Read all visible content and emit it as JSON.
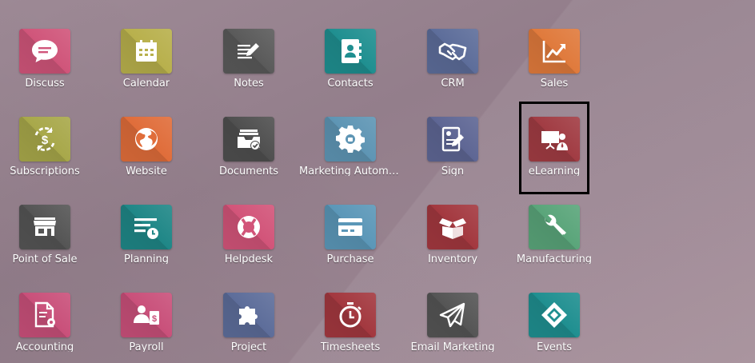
{
  "apps": [
    {
      "label": "Discuss",
      "icon": "chat-bubble-icon",
      "color": "#d0557a"
    },
    {
      "label": "Calendar",
      "icon": "calendar-icon",
      "color": "#b8b04c"
    },
    {
      "label": "Notes",
      "icon": "notes-icon",
      "color": "#5a5a5a"
    },
    {
      "label": "Contacts",
      "icon": "contacts-book-icon",
      "color": "#1f8f90"
    },
    {
      "label": "CRM",
      "icon": "handshake-icon",
      "color": "#5d6d9a"
    },
    {
      "label": "Sales",
      "icon": "chart-growth-icon",
      "color": "#e07a3c"
    },
    {
      "label": "Subscriptions",
      "icon": "recurring-dollar-icon",
      "color": "#a8a84a"
    },
    {
      "label": "Website",
      "icon": "globe-icon",
      "color": "#e06d3a"
    },
    {
      "label": "Documents",
      "icon": "document-tray-icon",
      "color": "#4f4f4f"
    },
    {
      "label": "Marketing Automat...",
      "icon": "gear-icon",
      "color": "#5e95b4"
    },
    {
      "label": "Sign",
      "icon": "signed-document-icon",
      "color": "#5e6694"
    },
    {
      "label": "eLearning",
      "icon": "presentation-teacher-icon",
      "color": "#a13c43"
    },
    {
      "label": "Point of Sale",
      "icon": "storefront-icon",
      "color": "#555555"
    },
    {
      "label": "Planning",
      "icon": "planning-bars-clock-icon",
      "color": "#1f8787"
    },
    {
      "label": "Helpdesk",
      "icon": "lifebuoy-icon",
      "color": "#d25479"
    },
    {
      "label": "Purchase",
      "icon": "credit-card-icon",
      "color": "#5b97b8"
    },
    {
      "label": "Inventory",
      "icon": "open-box-icon",
      "color": "#a3383f"
    },
    {
      "label": "Manufacturing",
      "icon": "wrench-icon",
      "color": "#5aa57a"
    },
    {
      "label": "Accounting",
      "icon": "invoice-gear-icon",
      "color": "#c9507a"
    },
    {
      "label": "Payroll",
      "icon": "employee-dollar-icon",
      "color": "#c9507a"
    },
    {
      "label": "Project",
      "icon": "puzzle-piece-icon",
      "color": "#5d6d9a"
    },
    {
      "label": "Timesheets",
      "icon": "stopwatch-icon",
      "color": "#a3383f"
    },
    {
      "label": "Email Marketing",
      "icon": "paper-plane-icon",
      "color": "#555555"
    },
    {
      "label": "Events",
      "icon": "ticket-icon",
      "color": "#1f8f90"
    }
  ]
}
